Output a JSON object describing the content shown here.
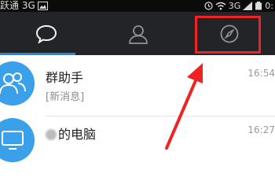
{
  "status_bar": {
    "carrier": "跃通 3G",
    "network": "3G",
    "time_partial": "0:"
  },
  "tabs": [
    {
      "name": "messages",
      "icon": "chat-bubble-icon",
      "active": true
    },
    {
      "name": "contacts",
      "icon": "person-icon",
      "active": false
    },
    {
      "name": "discover",
      "icon": "compass-icon",
      "active": false
    }
  ],
  "colors": {
    "tab_bar": "#222427",
    "active_tab_indicator": "#1e88e5",
    "annotation_red": "#f12222",
    "avatar_blue": "#3aa0ea"
  },
  "conversations": [
    {
      "title": "群助手",
      "subtitle": "[新消息]",
      "time": "16:54",
      "avatar_icon": "group-people-icon"
    },
    {
      "title": "的电脑",
      "subtitle": "",
      "time": "16:27",
      "avatar_icon": "computer-icon"
    }
  ]
}
